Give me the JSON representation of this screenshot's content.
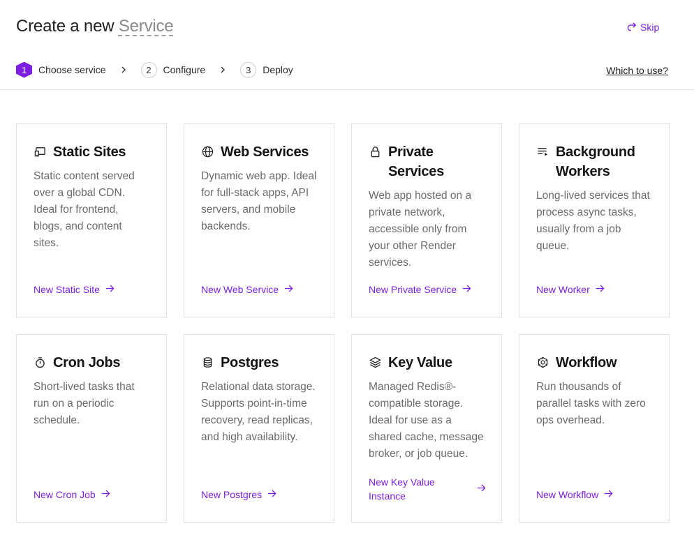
{
  "header": {
    "title_prefix": "Create a new ",
    "title_accent": "Service",
    "skip_label": "Skip",
    "which_label": "Which to use?"
  },
  "steps": [
    {
      "number": "1",
      "label": "Choose service",
      "state": "active"
    },
    {
      "number": "2",
      "label": "Configure",
      "state": "pending"
    },
    {
      "number": "3",
      "label": "Deploy",
      "state": "pending"
    }
  ],
  "cards": [
    {
      "icon": "static-site-icon",
      "title": "Static Sites",
      "description": "Static content served over a global CDN. Ideal for frontend, blogs, and content sites.",
      "link": "New Static Site"
    },
    {
      "icon": "globe-icon",
      "title": "Web Services",
      "description": "Dynamic web app. Ideal for full-stack apps, API servers, and mobile backends.",
      "link": "New Web Service"
    },
    {
      "icon": "lock-icon",
      "title": "Private Services",
      "description": "Web app hosted on a private network, accessible only from your other Render services.",
      "link": "New Private Service"
    },
    {
      "icon": "list-play-icon",
      "title": "Background Workers",
      "description": "Long-lived services that process async tasks, usually from a job queue.",
      "link": "New Worker"
    },
    {
      "icon": "stopwatch-icon",
      "title": "Cron Jobs",
      "description": "Short-lived tasks that run on a periodic schedule.",
      "link": "New Cron Job"
    },
    {
      "icon": "database-icon",
      "title": "Postgres",
      "description": "Relational data storage. Supports point-in-time recovery, read replicas, and high availability.",
      "link": "New Postgres"
    },
    {
      "icon": "layers-icon",
      "title": "Key Value",
      "description": "Managed Redis®-compatible storage. Ideal for use as a shared cache, message broker, or job queue.",
      "link": "New Key Value Instance"
    },
    {
      "icon": "workflow-icon",
      "title": "Workflow",
      "description": "Run thousands of parallel tasks with zero ops overhead.",
      "link": "New Workflow"
    }
  ],
  "colors": {
    "accent": "#7c1fe0",
    "text": "#1a1a1a",
    "muted": "#6b6b6b",
    "border": "#e0e0e0"
  }
}
